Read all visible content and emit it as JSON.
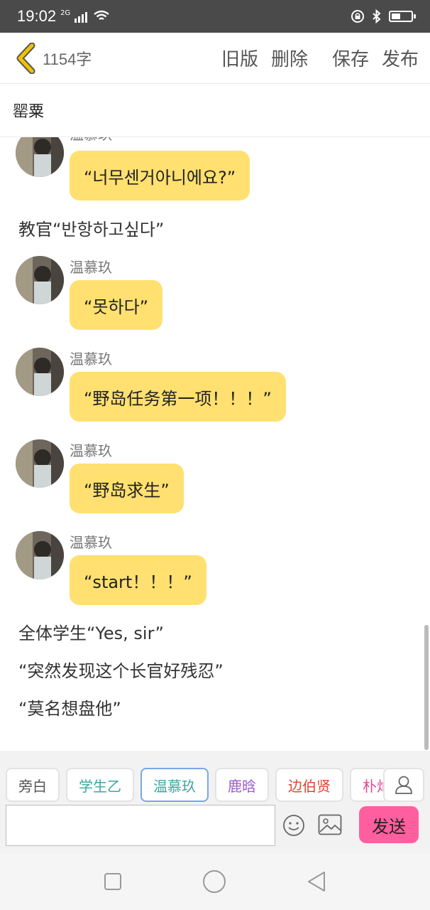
{
  "status_bar": {
    "time": "19:02",
    "network": "2G"
  },
  "toolbar": {
    "word_count": "1154字",
    "actions": [
      "旧版",
      "删除",
      "保存",
      "发布"
    ]
  },
  "title": "罂粟",
  "messages": [
    {
      "kind": "chat",
      "sender": "温慕玖",
      "text": "“너무센거아니에요?”"
    },
    {
      "kind": "narration",
      "text": "教官“반항하고싶다”"
    },
    {
      "kind": "chat",
      "sender": "温慕玖",
      "text": "“못하다”"
    },
    {
      "kind": "chat",
      "sender": "温慕玖",
      "text": "“野岛任务第一项！！！”"
    },
    {
      "kind": "chat",
      "sender": "温慕玖",
      "text": "“野岛求生”"
    },
    {
      "kind": "chat",
      "sender": "温慕玖",
      "text": "“start！！！”"
    },
    {
      "kind": "narration",
      "text": "全体学生“Yes, sir”"
    },
    {
      "kind": "narration",
      "text": "“突然发现这个长官好残忍”"
    },
    {
      "kind": "narration",
      "text": "“莫名想盘他”"
    }
  ],
  "characters": [
    {
      "name": "旁白",
      "color": "#555555"
    },
    {
      "name": "学生乙",
      "color": "#3aa9a0"
    },
    {
      "name": "温慕玖",
      "color": "#3aa9a0"
    },
    {
      "name": "鹿晗",
      "color": "#9b59d0"
    },
    {
      "name": "边伯贤",
      "color": "#e2442f"
    },
    {
      "name": "朴灿烈",
      "color": "#e0479a"
    }
  ],
  "active_character": "温慕玖",
  "composer": {
    "input_value": "",
    "send_label": "发送"
  },
  "colors": {
    "bubble": "#ffe070",
    "send": "#ff5f9e",
    "back_arrow": "#f2c200"
  }
}
